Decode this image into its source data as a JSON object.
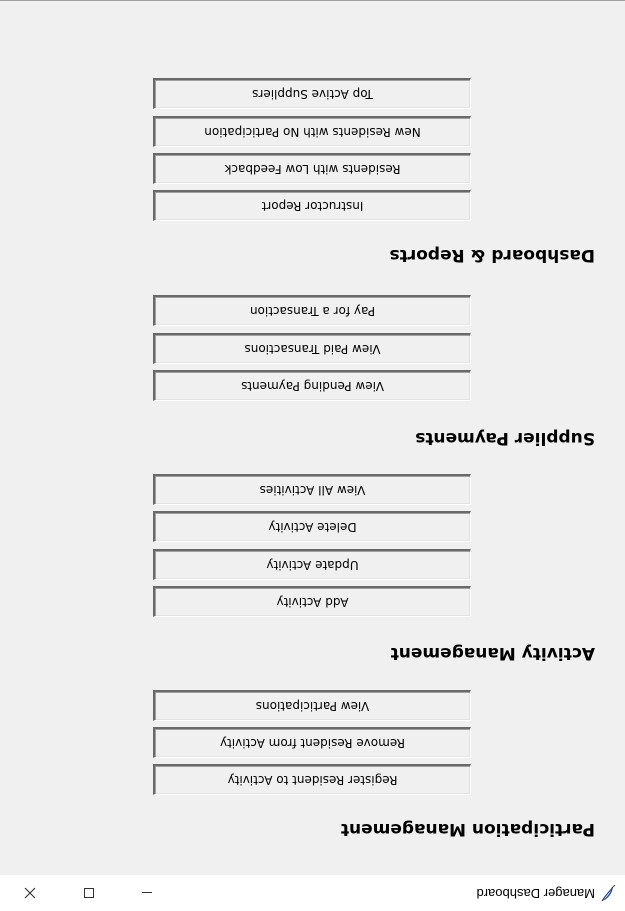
{
  "window": {
    "title": "Manager Dashboard",
    "icon": "feather-icon"
  },
  "sections": [
    {
      "title": "Participation Management",
      "buttons": [
        "Register Resident to Activity",
        "Remove Resident from Activity",
        "View Participations"
      ]
    },
    {
      "title": "Activity Management",
      "buttons": [
        "Add Activity",
        "Update Activity",
        "Delete Activity",
        "View All Activities"
      ]
    },
    {
      "title": "Supplier Payments",
      "buttons": [
        "View Pending Payments",
        "View Paid Transactions",
        "Pay for a Transaction"
      ]
    },
    {
      "title": "Dashboard & Reports",
      "buttons": [
        "Instructor Report",
        "Residents with Low Feedback",
        "New Residents with No Participation",
        "Top Active Suppliers"
      ]
    }
  ]
}
